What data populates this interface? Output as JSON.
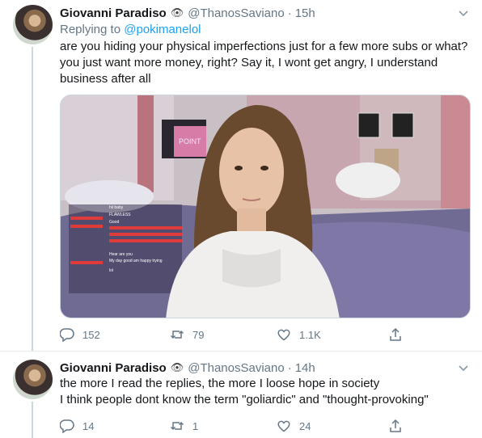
{
  "tweets": [
    {
      "name": "Giovanni Paradiso",
      "handle": "@ThanosSaviano",
      "time": "15h",
      "replying_label": "Replying to ",
      "replying_to": "@pokimanelol",
      "text_lines": [
        "are you hiding your physical imperfections just for a few more subs or what?",
        "you just want more money, right? Say it, I wont get angry, I understand",
        "business after all"
      ],
      "replies": "152",
      "retweets": "79",
      "likes": "1.1K"
    },
    {
      "name": "Giovanni Paradiso",
      "handle": "@ThanosSaviano",
      "time": "14h",
      "text_lines": [
        "the more I read the replies, the more I loose hope in society",
        "I think people dont know the term \"goliardic\" and \"thought-provoking\""
      ],
      "replies": "14",
      "retweets": "1",
      "likes": "24"
    }
  ],
  "media_overlay": {
    "chat_lines": [
      "hii baby",
      "FLAWLESS",
      "Good",
      "Hear are you",
      "My day good am happy trying",
      "lol"
    ],
    "wall_sign": "POINT"
  },
  "colors": {
    "text": "#14171a",
    "muted": "#657786",
    "link": "#1da1f2",
    "border": "#e6ecf0"
  },
  "icons": [
    "chevron-down-icon",
    "eye-icon",
    "reply-icon",
    "retweet-icon",
    "like-icon",
    "share-icon"
  ]
}
